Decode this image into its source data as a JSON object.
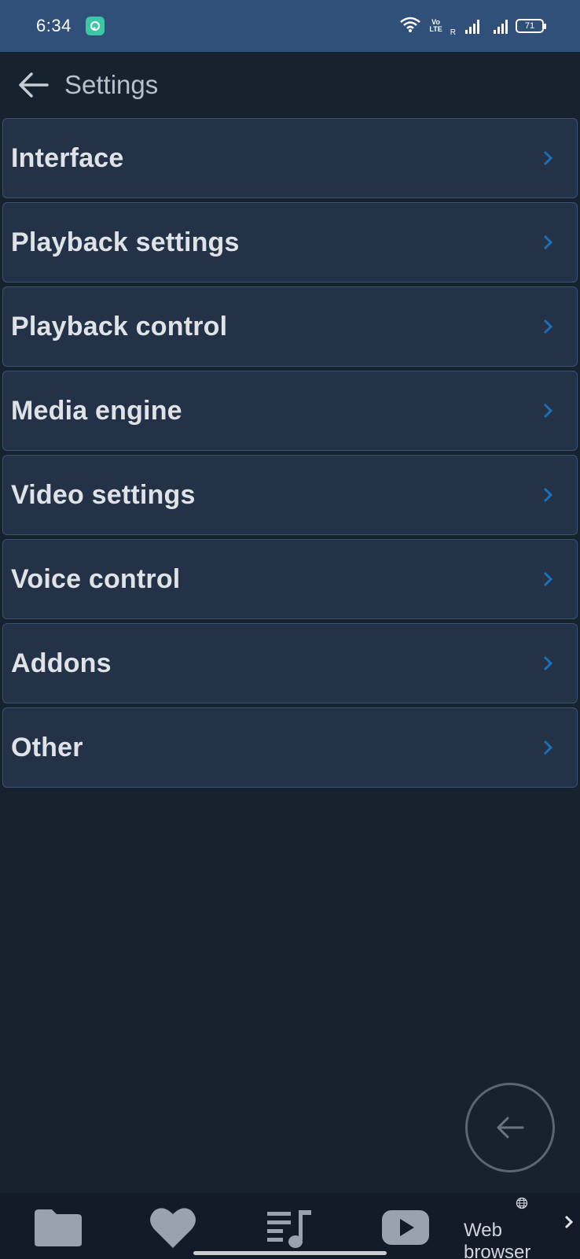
{
  "status_bar": {
    "time": "6:34",
    "volte_top": "Vo",
    "volte_bottom": "LTE",
    "roaming": "R",
    "battery": "71"
  },
  "header": {
    "title": "Settings"
  },
  "settings": {
    "items": [
      {
        "label": "Interface"
      },
      {
        "label": "Playback settings"
      },
      {
        "label": "Playback control"
      },
      {
        "label": "Media engine"
      },
      {
        "label": "Video settings"
      },
      {
        "label": "Voice control"
      },
      {
        "label": "Addons"
      },
      {
        "label": "Other"
      }
    ]
  },
  "bottom_nav": {
    "web_browser_line1": "Web",
    "web_browser_line2": "browser",
    "icons": [
      "folder-icon",
      "heart-icon",
      "playlist-icon",
      "youtube-icon",
      "globe-icon",
      "chevron-right-icon"
    ]
  },
  "colors": {
    "background": "#17222f",
    "status_bar": "#30507a",
    "item_background": "#243247",
    "item_border": "#3b5272",
    "chevron": "#1f6fb5",
    "nav_icon": "#9aa3ad"
  }
}
